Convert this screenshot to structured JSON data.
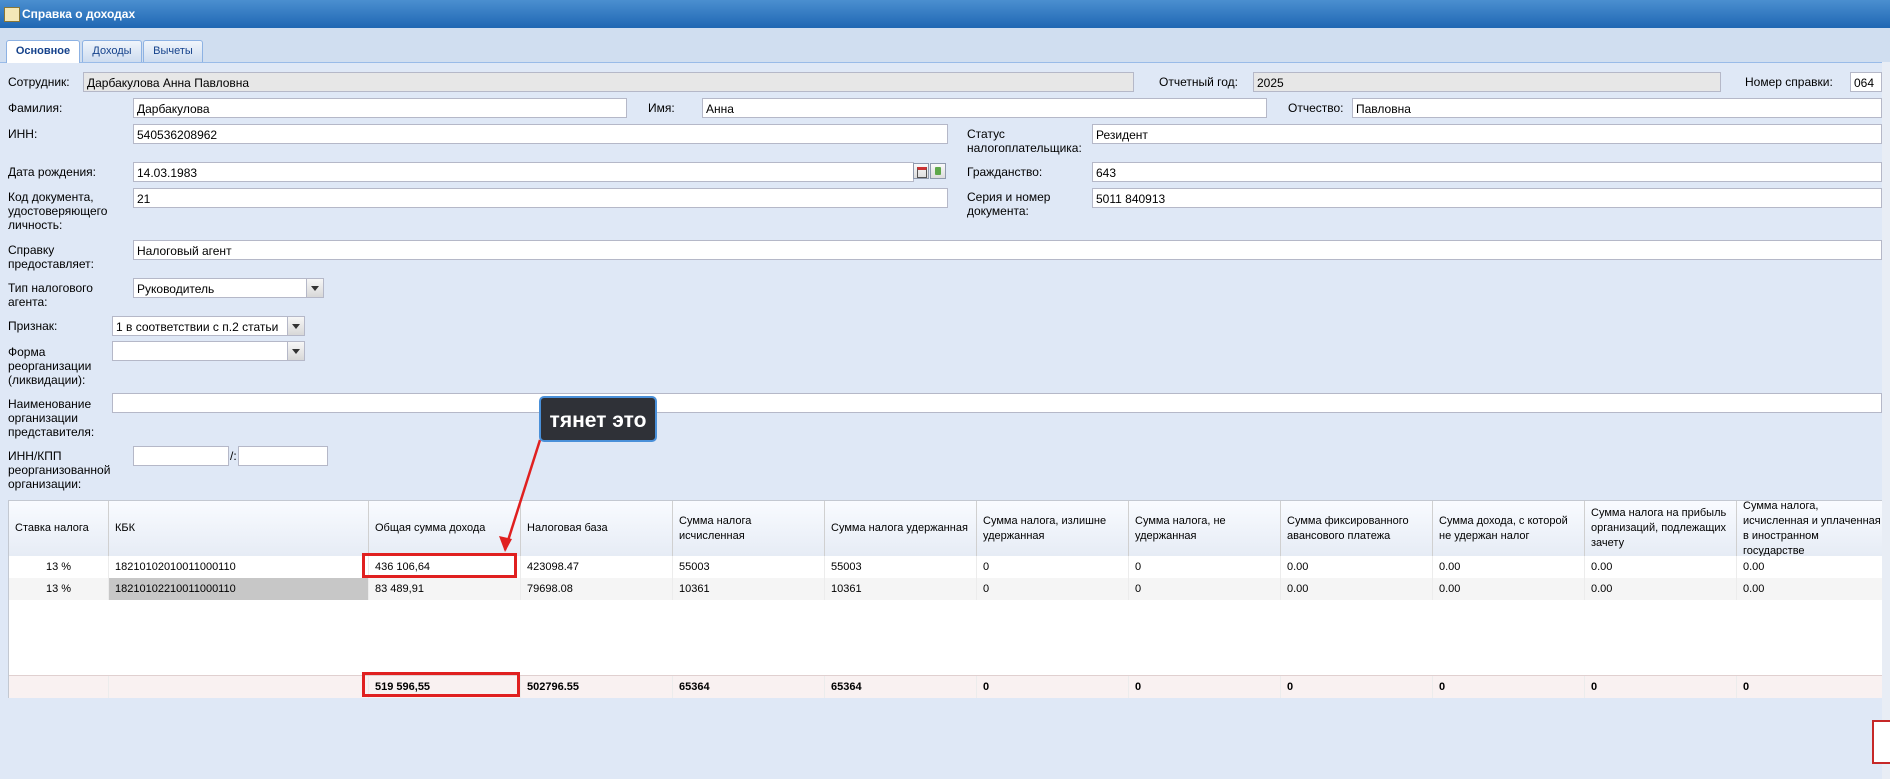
{
  "window": {
    "title": "Справка о доходах"
  },
  "tabs": [
    {
      "label": "Основное"
    },
    {
      "label": "Доходы"
    },
    {
      "label": "Вычеты"
    }
  ],
  "form": {
    "employee_label": "Сотрудник:",
    "employee_value": "Дарбакулова Анна Павловна",
    "year_label": "Отчетный год:",
    "year_value": "2025",
    "certnum_label": "Номер справки:",
    "certnum_value": "064",
    "lastname_label": "Фамилия:",
    "lastname_value": "Дарбакулова",
    "firstname_label": "Имя:",
    "firstname_value": "Анна",
    "patronymic_label": "Отчество:",
    "patronymic_value": "Павловна",
    "inn_label": "ИНН:",
    "inn_value": "540536208962",
    "status_label": "Статус налогоплательщика:",
    "status_value": "Резидент",
    "birthdate_label": "Дата рождения:",
    "birthdate_value": "14.03.1983",
    "citizenship_label": "Гражданство:",
    "citizenship_value": "643",
    "doccode_label": "Код документа, удостоверяющего личность:",
    "doccode_value": "21",
    "docseries_label": "Серия и номер документа:",
    "docseries_value": "5011 840913",
    "provider_label": "Справку предоставляет:",
    "provider_value": "Налоговый агент",
    "agenttype_label": "Тип налогового агента:",
    "agenttype_value": "Руководитель",
    "sign_label": "Признак:",
    "sign_value": "1 в соответствии с п.2 статьи",
    "reorgform_label": "Форма реорганизации (ликвидации):",
    "reorgform_value": "",
    "repname_label": "Наименование организации представителя:",
    "repname_value": "",
    "innkpp_label": "ИНН/КПП реорганизованной организации:",
    "innkpp_sep": "/:"
  },
  "grid": {
    "columns": [
      "Ставка налога",
      "КБК",
      "Общая сумма дохода",
      "Налоговая база",
      "Сумма налога исчисленная",
      "Сумма налога удержанная",
      "Сумма налога, излишне удержанная",
      "Сумма налога, не удержанная",
      "Сумма фиксированного авансового платежа",
      "Сумма дохода, с которой не удержан налог",
      "Сумма налога на прибыль организаций, подлежащих зачету",
      "Сумма налога, исчисленная и уплаченная в иностранном государстве"
    ],
    "rows": [
      [
        "13 %",
        "18210102010011000110",
        "436 106,64",
        "423098.47",
        "55003",
        "55003",
        "0",
        "0",
        "0.00",
        "0.00",
        "0.00",
        "0.00"
      ],
      [
        "13 %",
        "18210102210011000110",
        "83 489,91",
        "79698.08",
        "10361",
        "10361",
        "0",
        "0",
        "0.00",
        "0.00",
        "0.00",
        "0.00"
      ]
    ],
    "totals": [
      "",
      "",
      "519 596,55",
      "502796.55",
      "65364",
      "65364",
      "0",
      "0",
      "0",
      "0",
      "0",
      "0"
    ]
  },
  "annotation": {
    "text": "тянет это",
    "color": "#e02020"
  }
}
